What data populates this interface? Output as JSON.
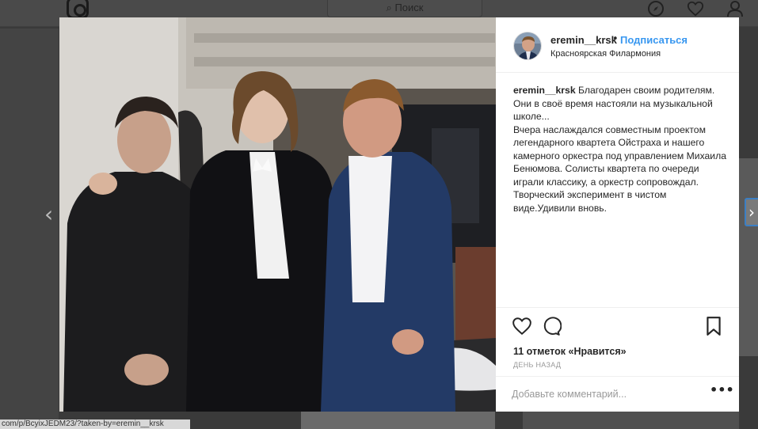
{
  "header": {
    "search_placeholder": "Поиск",
    "icons": [
      "instagram-logo-icon",
      "search-icon",
      "compass-icon",
      "heart-icon",
      "profile-icon"
    ]
  },
  "url_bar": {
    "text": "com/p/BcyixJEDM23/?taken-by=eremin__krsk"
  },
  "post": {
    "username": "eremin__krsk",
    "separator": "•",
    "follow_label": "Подписаться",
    "location": "Красноярская Филармония",
    "caption_user": "eremin__krsk",
    "caption_text": " Благодарен своим родителям. Они в своё время настояли на музыкальной школе...",
    "caption_text_2": "Вчера наслаждался совместным проектом легендарного квартета Ойстраха и нашего камерного оркестра под управлением Михаила Бенюмова. Солисты квартета по очереди играли классику, а оркестр сопровождал. Творческий эксперимент в чистом виде.Удивили вновь.",
    "likes": "11 отметок «Нравится»",
    "time": "День назад",
    "comment_placeholder": "Добавьте комментарий...",
    "more_label": "•••",
    "carousel": {
      "count": 4,
      "active": 1
    }
  },
  "colors": {
    "link_blue": "#3897f0",
    "text": "#262626",
    "muted": "#999999",
    "overlay": "#3a3a3a"
  }
}
